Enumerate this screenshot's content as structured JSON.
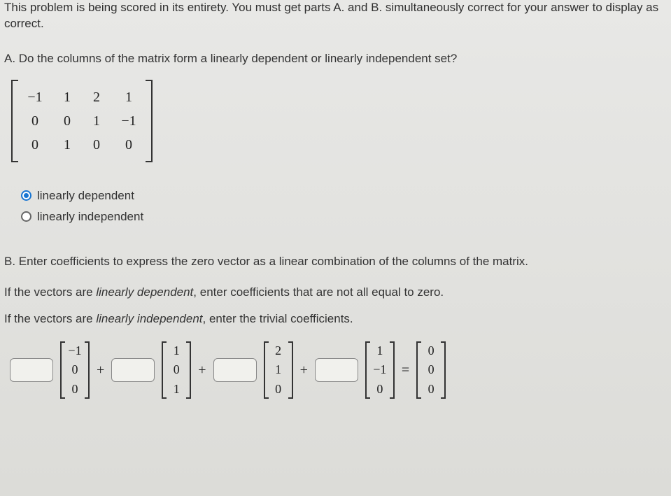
{
  "intro": "This problem is being scored in its entirety. You must get parts A. and B. simultaneously correct for your answer to display as correct.",
  "partA": {
    "question": "A. Do the columns of the matrix form a linearly dependent or linearly independent set?",
    "matrix": [
      [
        "−1",
        "1",
        "2",
        "1"
      ],
      [
        "0",
        "0",
        "1",
        "−1"
      ],
      [
        "0",
        "1",
        "0",
        "0"
      ]
    ],
    "options": {
      "dependent": "linearly dependent",
      "independent": "linearly independent"
    },
    "selected": "dependent"
  },
  "partB": {
    "intro1": "B. Enter coefficients to express the zero vector as a linear combination of the columns of the matrix.",
    "instr1_pre": "If the vectors are ",
    "instr1_em": "linearly dependent",
    "instr1_post": ", enter coefficients that are not all equal to zero.",
    "instr2_pre": "If the vectors are ",
    "instr2_em": "linearly independent",
    "instr2_post": ", enter the trivial coefficients.",
    "vectors": {
      "v1": [
        "−1",
        "0",
        "0"
      ],
      "v2": [
        "1",
        "0",
        "1"
      ],
      "v3": [
        "2",
        "1",
        "0"
      ],
      "v4": [
        "1",
        "−1",
        "0"
      ],
      "zero": [
        "0",
        "0",
        "0"
      ]
    },
    "ops": {
      "plus": "+",
      "eq": "="
    }
  }
}
